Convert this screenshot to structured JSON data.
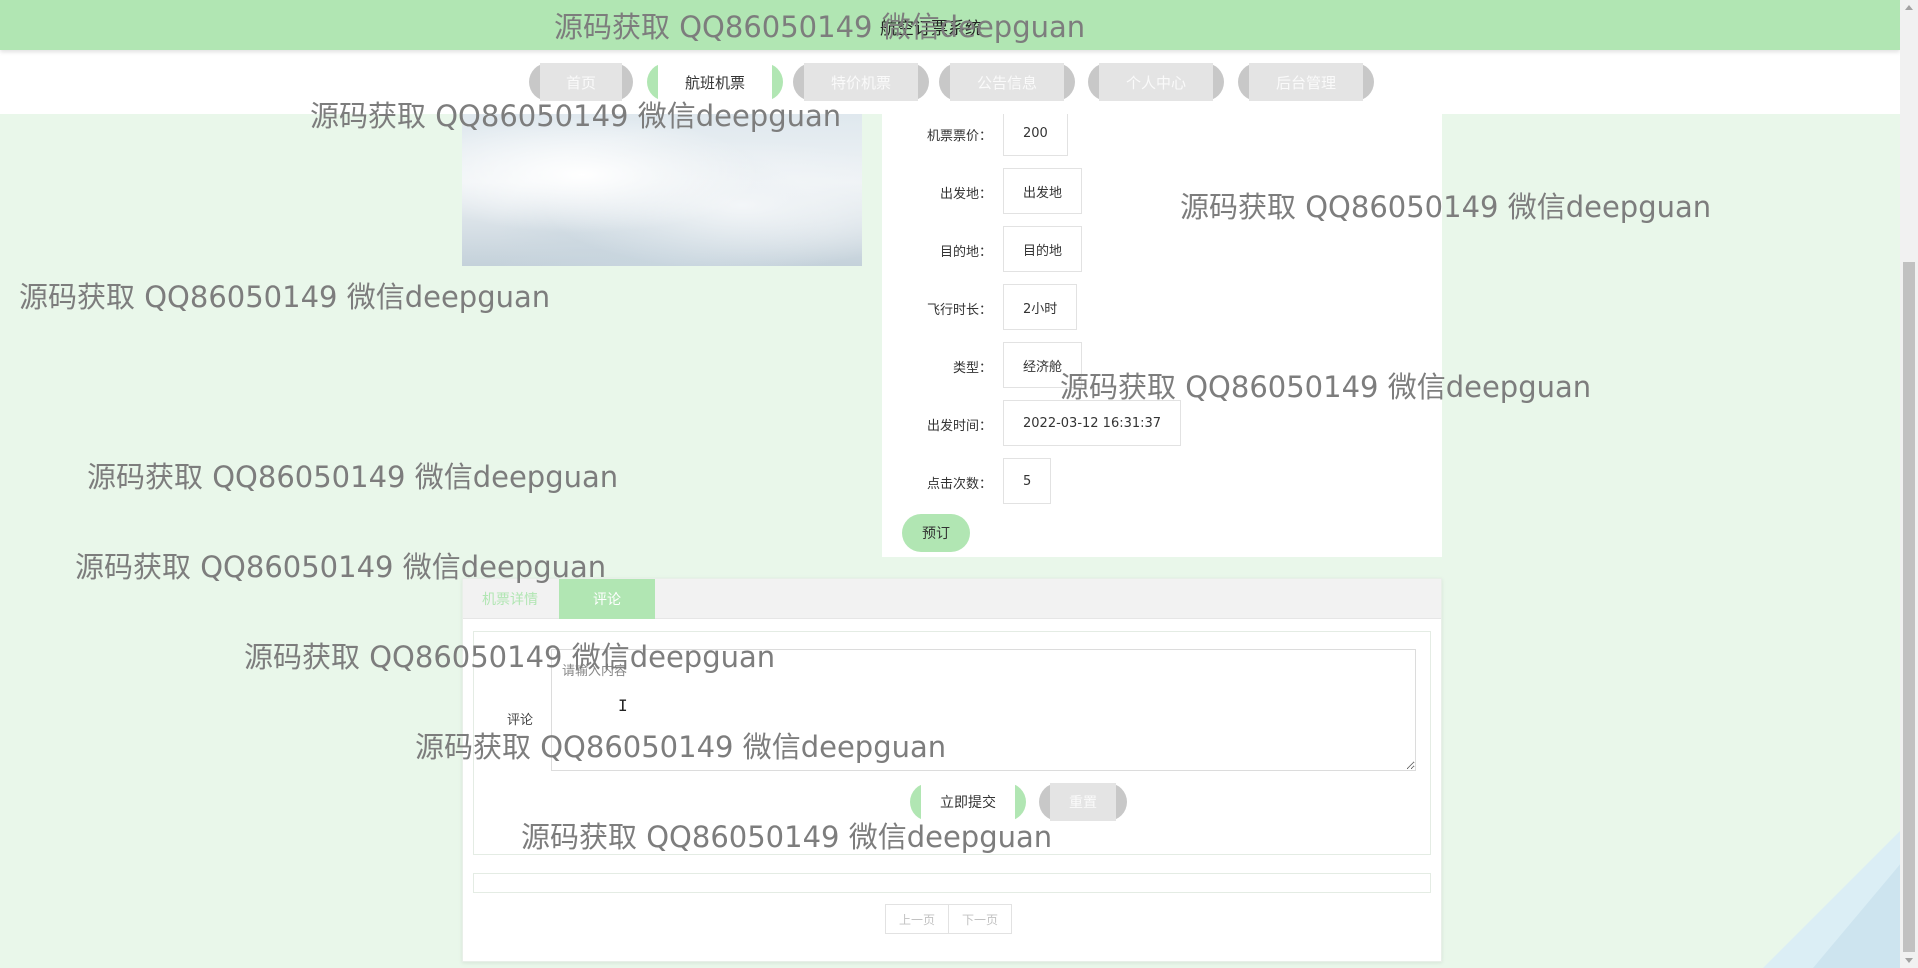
{
  "header": {
    "title": "航空订票系统",
    "accent_color": "#b1e6b3"
  },
  "nav": {
    "items": [
      {
        "label": "首页",
        "active": false
      },
      {
        "label": "航班机票",
        "active": true
      },
      {
        "label": "特价机票",
        "active": false
      },
      {
        "label": "公告信息",
        "active": false
      },
      {
        "label": "个人中心",
        "active": false
      },
      {
        "label": "后台管理",
        "active": false
      }
    ]
  },
  "detail": {
    "fields": [
      {
        "label": "机票票价：",
        "value": "200"
      },
      {
        "label": "出发地：",
        "value": "出发地"
      },
      {
        "label": "目的地：",
        "value": "目的地"
      },
      {
        "label": "飞行时长：",
        "value": "2小时"
      },
      {
        "label": "类型：",
        "value": "经济舱"
      },
      {
        "label": "出发时间：",
        "value": "2022-03-12 16:31:37"
      },
      {
        "label": "点击次数：",
        "value": "5"
      }
    ],
    "book_label": "预订"
  },
  "tabs": {
    "items": [
      {
        "label": "机票详情",
        "active": false
      },
      {
        "label": "评论",
        "active": true
      }
    ]
  },
  "comment": {
    "label": "评论",
    "placeholder": "请输入内容",
    "value": "",
    "submit_label": "立即提交",
    "reset_label": "重置"
  },
  "pager": {
    "prev_label": "上一页",
    "next_label": "下一页"
  },
  "watermark": {
    "text": "源码获取 QQ86050149 微信deepguan"
  }
}
